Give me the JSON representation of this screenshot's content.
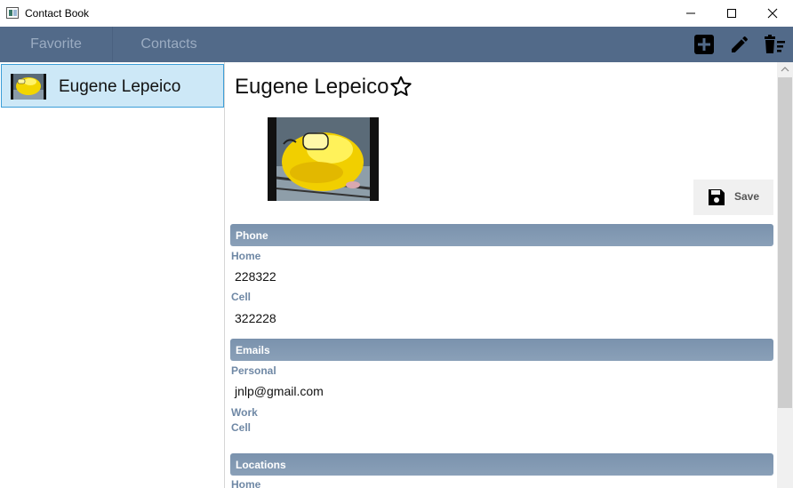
{
  "window": {
    "title": "Contact Book"
  },
  "tabs": [
    {
      "label": "Favorite"
    },
    {
      "label": "Contacts"
    }
  ],
  "toolbar": {
    "add_icon": "add-icon",
    "edit_icon": "pencil-icon",
    "delete_icon": "delete-list-icon"
  },
  "contacts": [
    {
      "name": "Eugene Lepeico",
      "avatar": "avatar-image"
    }
  ],
  "detail": {
    "name": "Eugene Lepeico",
    "favorite_icon": "star-outline-icon",
    "save_label": "Save",
    "phone": {
      "header": "Phone",
      "home_label": "Home",
      "home_value": "228322",
      "cell_label": "Cell",
      "cell_value": "322228"
    },
    "emails": {
      "header": "Emails",
      "personal_label": "Personal",
      "personal_value": "jnlp@gmail.com",
      "work_label": "Work",
      "cell_label": "Cell"
    },
    "locations": {
      "header": "Locations",
      "home_label": "Home"
    }
  },
  "colors": {
    "toolbar": "#526a89",
    "section_header": "#8aa0b8",
    "field_label": "#6f88a5",
    "selection": "#cde8f7",
    "selection_border": "#3c9ed8"
  }
}
